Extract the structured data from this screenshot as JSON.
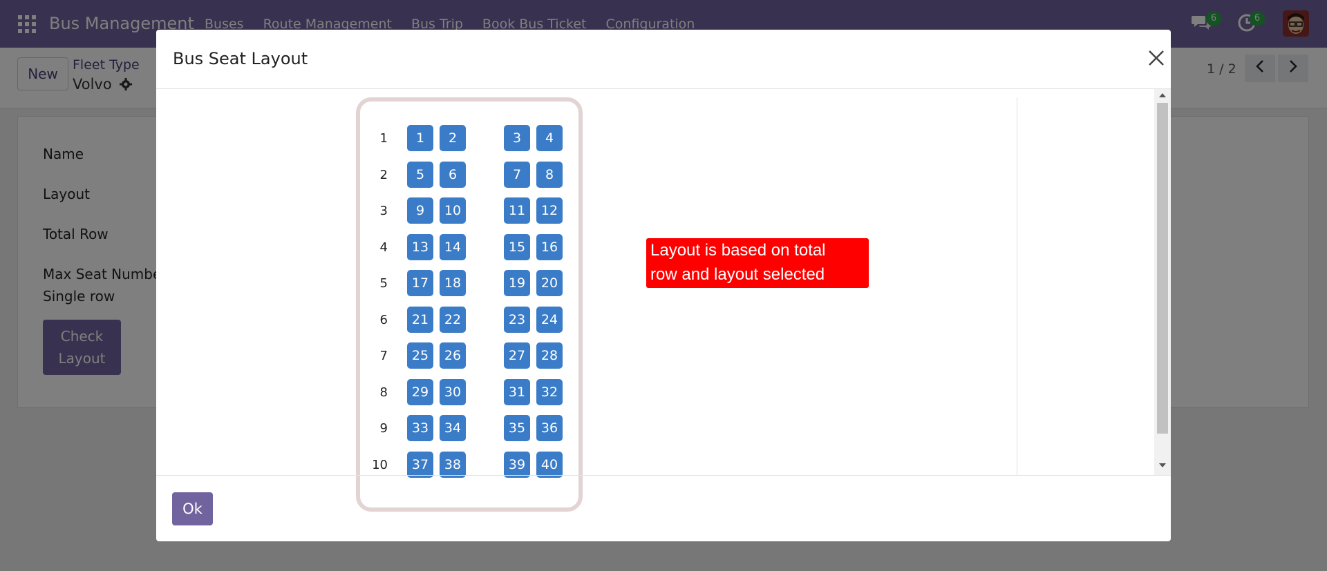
{
  "navbar": {
    "brand": "Bus Management",
    "menu": [
      "Buses",
      "Route Management",
      "Bus Trip",
      "Book Bus Ticket",
      "Configuration"
    ],
    "chat_count": "6",
    "activity_count": "6"
  },
  "control_panel": {
    "new_label": "New",
    "breadcrumb_parent": "Fleet Type",
    "breadcrumb_current": "Volvo",
    "pager": "1 / 2"
  },
  "form": {
    "labels": [
      "Name",
      "Layout",
      "Total Row",
      "Max Seat Number",
      "Single row"
    ],
    "check_layout_label_1": "Check",
    "check_layout_label_2": "Layout"
  },
  "modal": {
    "title": "Bus Seat Layout",
    "ok_label": "Ok",
    "rows": [
      {
        "row": "1",
        "seats": [
          "1",
          "2",
          "3",
          "4"
        ]
      },
      {
        "row": "2",
        "seats": [
          "5",
          "6",
          "7",
          "8"
        ]
      },
      {
        "row": "3",
        "seats": [
          "9",
          "10",
          "11",
          "12"
        ]
      },
      {
        "row": "4",
        "seats": [
          "13",
          "14",
          "15",
          "16"
        ]
      },
      {
        "row": "5",
        "seats": [
          "17",
          "18",
          "19",
          "20"
        ]
      },
      {
        "row": "6",
        "seats": [
          "21",
          "22",
          "23",
          "24"
        ]
      },
      {
        "row": "7",
        "seats": [
          "25",
          "26",
          "27",
          "28"
        ]
      },
      {
        "row": "8",
        "seats": [
          "29",
          "30",
          "31",
          "32"
        ]
      },
      {
        "row": "9",
        "seats": [
          "33",
          "34",
          "35",
          "36"
        ]
      },
      {
        "row": "10",
        "seats": [
          "37",
          "38",
          "39",
          "40"
        ]
      }
    ]
  },
  "annotation": {
    "line1": "Layout is based on total",
    "line2": "row and layout selected"
  },
  "colors": {
    "brand": "#71639e",
    "seat": "#3a7cc7",
    "annotation": "#ff0000"
  }
}
